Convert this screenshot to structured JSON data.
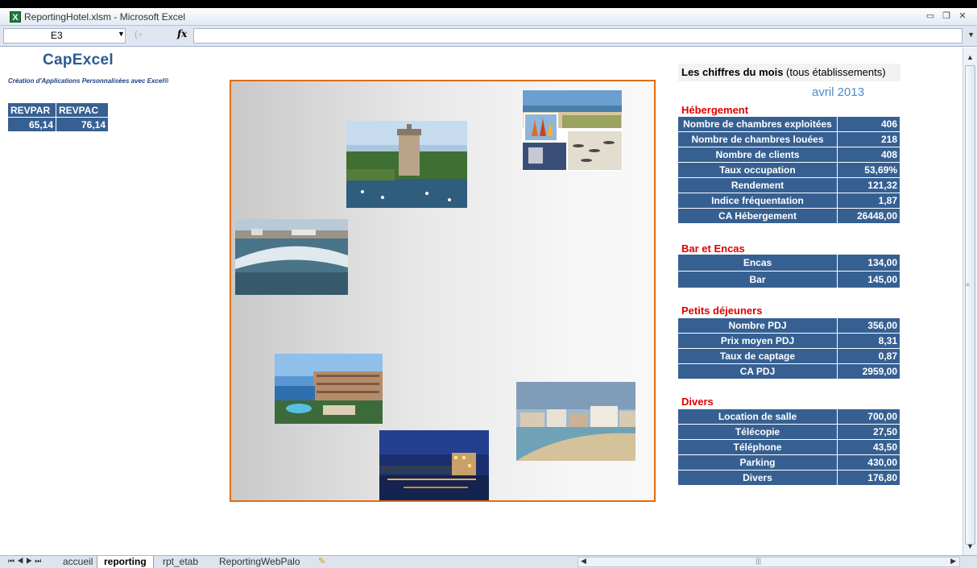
{
  "window": {
    "title": "ReportingHotel.xlsm - Microsoft Excel",
    "app_icon": "excel-icon",
    "controls": [
      "minimize-icon",
      "restore-icon",
      "close-icon"
    ]
  },
  "formula_bar": {
    "name_box": "E3",
    "fx_label": "fx",
    "formula": ""
  },
  "logo": {
    "name": "CapExcel",
    "subtitle": "Création d'Applications Personnalisées avec Excel®"
  },
  "kpis": {
    "headers": [
      "REVPAR",
      "REVPAC"
    ],
    "values": [
      "65,14",
      "76,14"
    ]
  },
  "photos": [
    "chateau-harbor-photo",
    "beach-sailboats-photo",
    "ocean-wave-photo",
    "hotel-pool-photo",
    "city-beach-photo",
    "harbor-night-photo"
  ],
  "panel": {
    "title_bold": "Les chiffres du mois",
    "title_rest": " (tous établissements)",
    "month": "avril 2013",
    "sections": [
      {
        "title": "Hébergement",
        "rows": [
          {
            "label": "Nombre de chambres exploitées",
            "value": "406"
          },
          {
            "label": "Nombre de chambres louées",
            "value": "218"
          },
          {
            "label": "Nombre de clients",
            "value": "408"
          },
          {
            "label": "Taux occupation",
            "value": "53,69%"
          },
          {
            "label": "Rendement",
            "value": "121,32"
          },
          {
            "label": "Indice fréquentation",
            "value": "1,87"
          },
          {
            "label": "CA Hébergement",
            "value": "26448,00"
          }
        ]
      },
      {
        "title": "Bar et Encas",
        "rows": [
          {
            "label": "Encas",
            "value": "134,00"
          },
          {
            "label": "Bar",
            "value": "145,00"
          }
        ]
      },
      {
        "title": "Petits déjeuners",
        "rows": [
          {
            "label": "Nombre PDJ",
            "value": "356,00"
          },
          {
            "label": "Prix moyen PDJ",
            "value": "8,31"
          },
          {
            "label": "Taux de captage",
            "value": "0,87"
          },
          {
            "label": "CA PDJ",
            "value": "2959,00"
          }
        ]
      },
      {
        "title": "Divers",
        "rows": [
          {
            "label": "Location de salle",
            "value": "700,00"
          },
          {
            "label": "Télécopie",
            "value": "27,50"
          },
          {
            "label": "Téléphone",
            "value": "43,50"
          },
          {
            "label": "Parking",
            "value": "430,00"
          },
          {
            "label": "Divers",
            "value": "176,80"
          }
        ]
      }
    ]
  },
  "sheet_tabs": [
    "accueil",
    "reporting",
    "rpt_etab",
    "ReportingWebPalo"
  ],
  "active_tab": "reporting",
  "colors": {
    "table_blue": "#366092",
    "frame_orange": "#e36c0a",
    "section_red": "#e00000",
    "month_blue": "#4a8ac8"
  }
}
